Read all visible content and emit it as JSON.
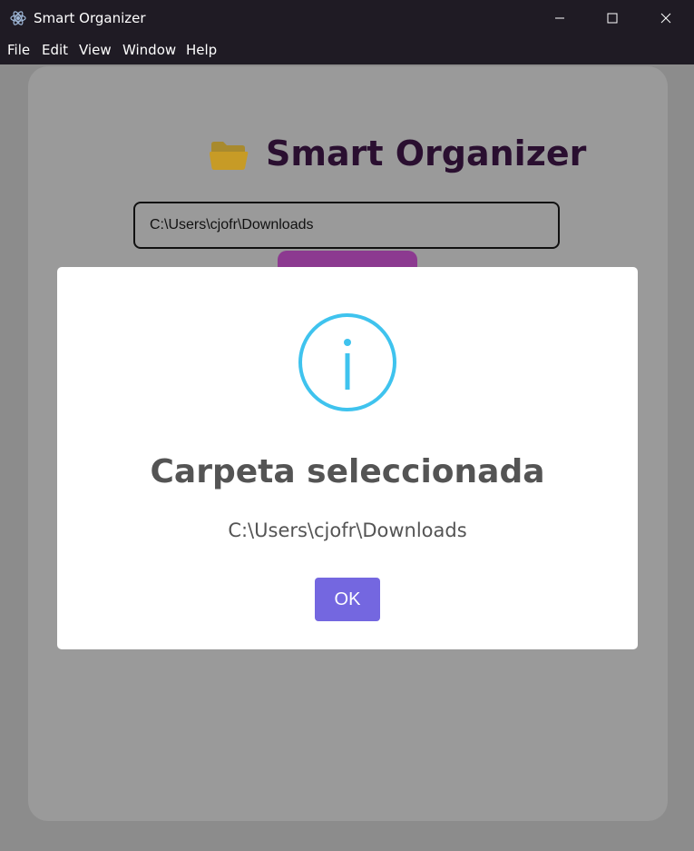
{
  "window": {
    "title": "Smart Organizer",
    "controls": [
      "minimize",
      "maximize",
      "close"
    ]
  },
  "menu": {
    "items": [
      "File",
      "Edit",
      "View",
      "Window",
      "Help"
    ]
  },
  "app": {
    "heading": "Smart Organizer",
    "heading_icon": "folder-icon",
    "path_value": "C:\\Users\\cjofr\\Downloads"
  },
  "dialog": {
    "icon": "info-icon",
    "title": "Carpeta seleccionada",
    "message": "C:\\Users\\cjofr\\Downloads",
    "ok_label": "OK"
  },
  "colors": {
    "accent_button": "#7467e0",
    "info_icon": "#3fc3ee",
    "heading": "#2a0f30",
    "select_button": "#8c3a90"
  }
}
